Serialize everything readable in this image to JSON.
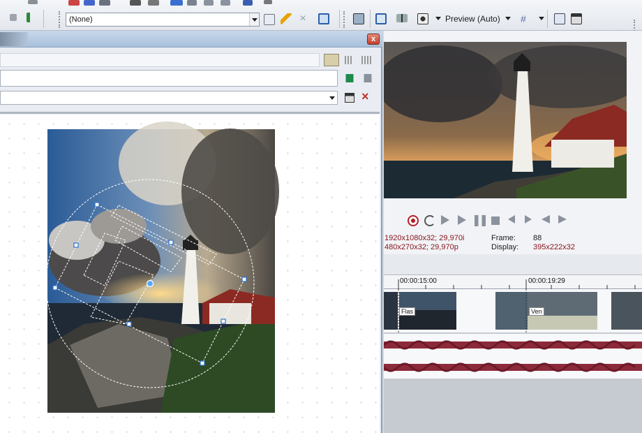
{
  "toolbar": {
    "preset_value": "(None)",
    "preview_mode": "Preview (Auto)"
  },
  "dialog": {
    "close_label": "x"
  },
  "preview": {
    "info": {
      "project_res": "1920x1080x32; 29,970i",
      "preview_res": "480x270x32; 29,970p",
      "frame_label": "Frame:",
      "frame_value": "88",
      "display_label": "Display:",
      "display_value": "395x222x32"
    }
  },
  "timeline": {
    "timecodes": [
      "00:00:15:00",
      "00:00:19:29"
    ],
    "clip_labels": [
      "Flas",
      "Ven"
    ]
  },
  "colors": {
    "accent_red": "#8a1620",
    "waveform": "#8c2a3a",
    "dialog_title": "#a9c1db"
  }
}
